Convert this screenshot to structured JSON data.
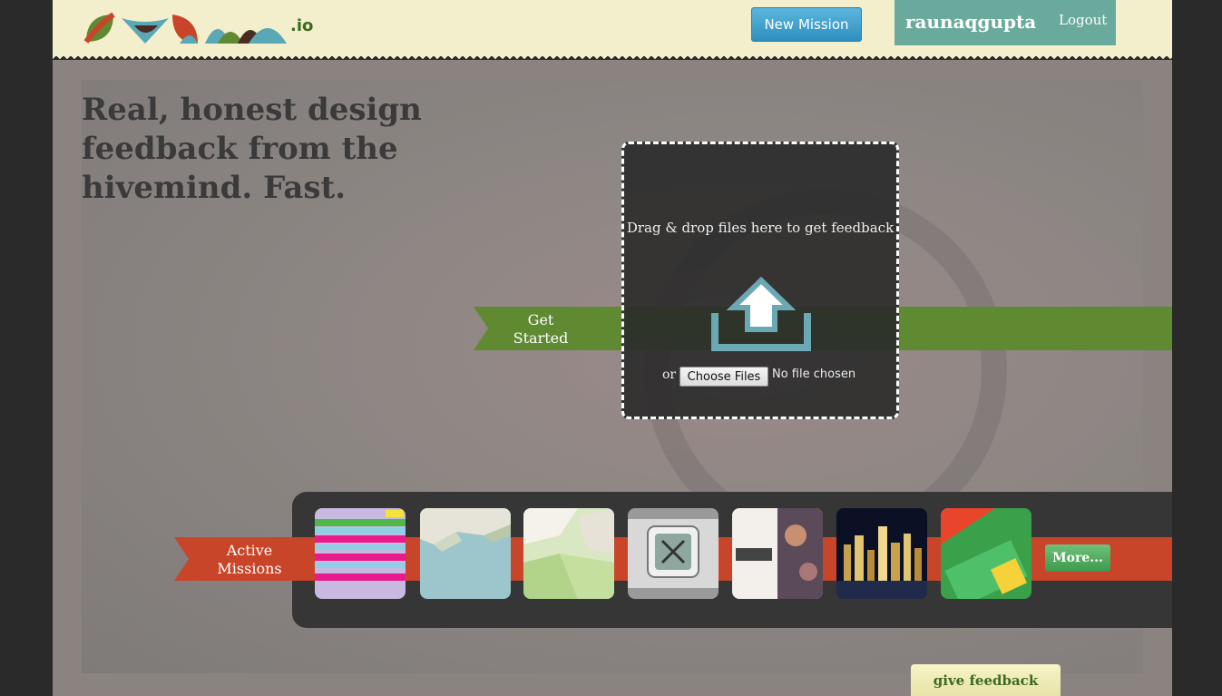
{
  "header": {
    "logo_suffix": ".io",
    "new_mission_label": "New Mission",
    "username": "raunaqgupta",
    "logout_label": "Logout"
  },
  "hero": {
    "tagline": "Real, honest design feedback from the hivemind. Fast.",
    "get_started": "Get Started",
    "upload": {
      "instructions": "Drag & drop files here to get feedback",
      "or_label": "or",
      "choose_button": "Choose Files",
      "no_file_text": "No file chosen"
    }
  },
  "missions": {
    "label": "Active Missions",
    "more_label": "More...",
    "thumbnails": [
      {
        "name": "history-summary",
        "bg": "#c7b9e0"
      },
      {
        "name": "low-poly-water",
        "bg": "#9cc6cc"
      },
      {
        "name": "low-poly-grass",
        "bg": "#b8d49a"
      },
      {
        "name": "kitchen-app-icon",
        "bg": "#9a9a9a"
      },
      {
        "name": "gallery-poster",
        "bg": "#e9e3dc"
      },
      {
        "name": "city-night",
        "bg": "#1a1f3a"
      },
      {
        "name": "grasshopper-homework",
        "bg": "#3aa14a"
      }
    ]
  },
  "feedback_tab": "give feedback",
  "colors": {
    "header_bg": "#f3efcd",
    "accent_blue": "#2f8fbf",
    "user_teal": "#6aaa9c",
    "band_green": "#5f8a32",
    "band_red": "#c8452a"
  }
}
